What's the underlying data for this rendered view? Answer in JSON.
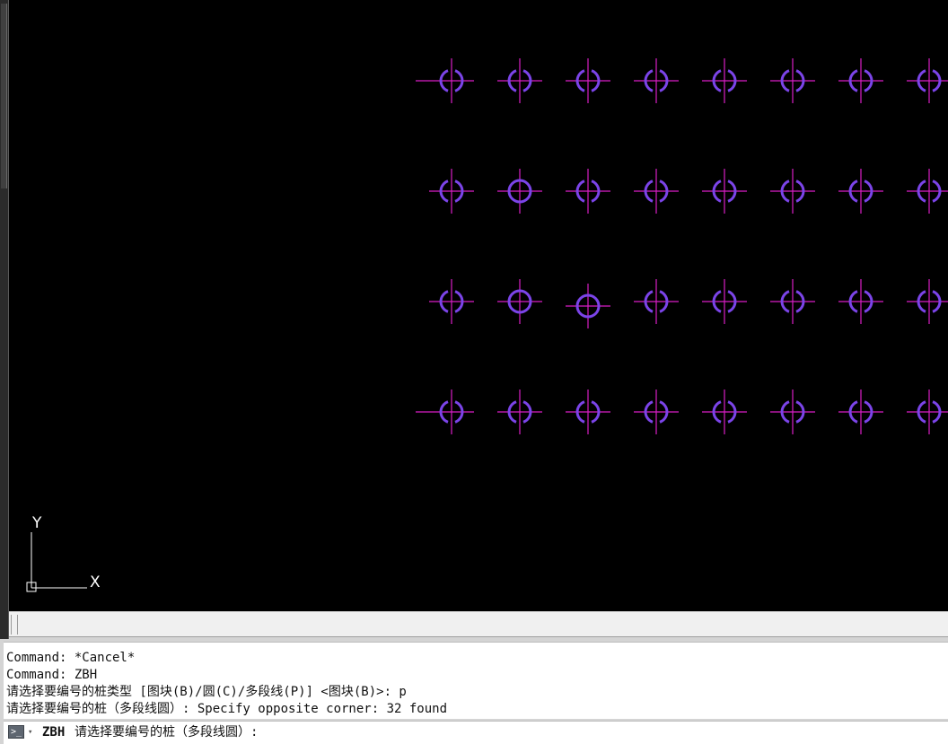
{
  "app": {
    "colors": {
      "background": "#000000",
      "pile_circle": "#7b44e8",
      "pile_cross": "#d91ec6",
      "ucs": "#ffffff"
    }
  },
  "drawing": {
    "pile_rows": 4,
    "pile_columns": 8,
    "selected_piles": [
      {
        "row": 2,
        "col": 2
      },
      {
        "row": 3,
        "col": 2
      },
      {
        "row": 3,
        "col": 3
      }
    ]
  },
  "ucs": {
    "x_label": "X",
    "y_label": "Y",
    "icon": "ucs-axis-icon"
  },
  "command_history": {
    "lines": [
      "Command: *Cancel*",
      "Command: ZBH",
      "请选择要编号的桩类型 [图块(B)/圆(C)/多段线(P)] <图块(B)>: p",
      "请选择要编号的桩（多段线圆）: Specify opposite corner: 32 found"
    ]
  },
  "command_line": {
    "icon": "command-prompt-icon",
    "icon_glyph": ">_",
    "caret_glyph": "▾",
    "command": "ZBH",
    "prompt": "请选择要编号的桩（多段线圆）:"
  }
}
